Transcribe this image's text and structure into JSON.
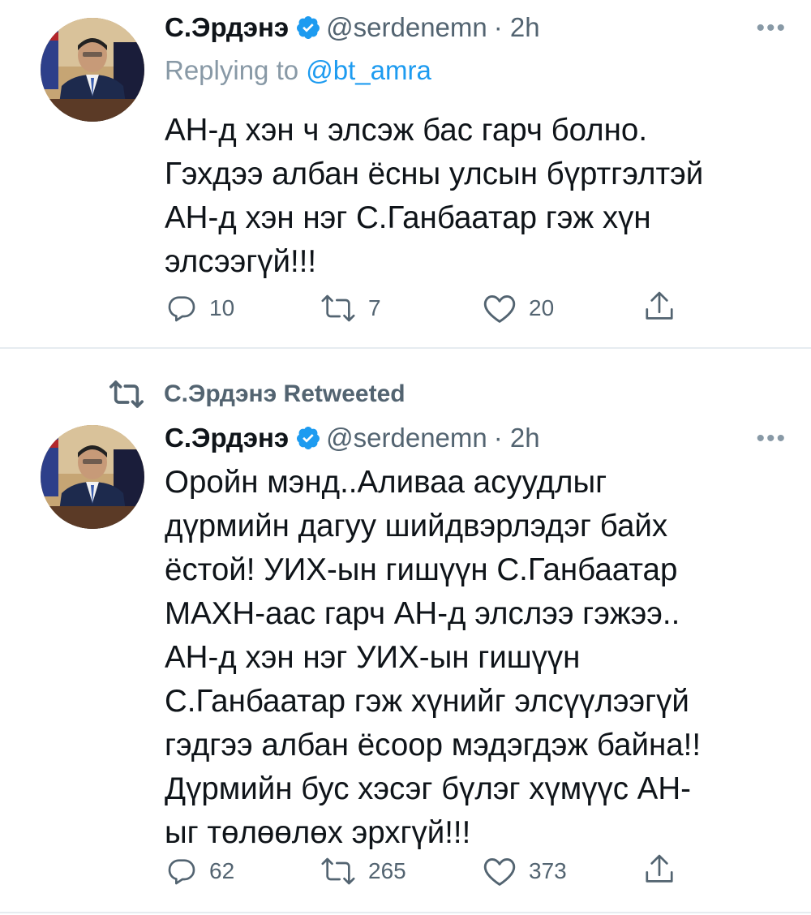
{
  "tweets": [
    {
      "author": {
        "name": "С.Эрдэнэ",
        "handle": "@serdenemn",
        "time": "· 2h"
      },
      "replying_prefix": "Replying to",
      "replying_to": "@bt_amra",
      "text": "АН-д хэн ч элсэж бас гарч болно.\nГэхдээ албан ёсны улсын бүртгэлтэй\nАН-д хэн нэг С.Ганбаатар гэж хүн\nэлсээгүй!!!",
      "stats": {
        "replies": "10",
        "retweets": "7",
        "likes": "20"
      },
      "icons": [
        "reply-icon",
        "retweet-icon",
        "like-icon",
        "share-icon"
      ]
    },
    {
      "retweet_banner": "С.Эрдэнэ Retweeted",
      "author": {
        "name": "С.Эрдэнэ",
        "handle": "@serdenemn",
        "time": "· 2h"
      },
      "text": "Оройн мэнд..Аливаа асуудлыг\nдүрмийн дагуу шийдвэрлэдэг байх\nёстой! УИХ-ын гишүүн С.Ганбаатар\nМАХН-аас гарч АН-д элслээ гэжээ..\nАН-д хэн нэг УИХ-ын гишүүн\nС.Ганбаатар гэж хүнийг элсүүлээгүй\nгэдгээ албан ёсоор мэдэгдэж байна!!\nДүрмийн бус хэсэг бүлэг хүмүүс АН-\nыг төлөөлөх эрхгүй!!!",
      "stats": {
        "replies": "62",
        "retweets": "265",
        "likes": "373"
      },
      "icons": [
        "reply-icon",
        "retweet-icon",
        "like-icon",
        "share-icon"
      ]
    }
  ],
  "colors": {
    "accent": "#1d9bf0",
    "muted": "#536471",
    "verified": "#1d9bf0",
    "divider": "#e6ecf0"
  }
}
